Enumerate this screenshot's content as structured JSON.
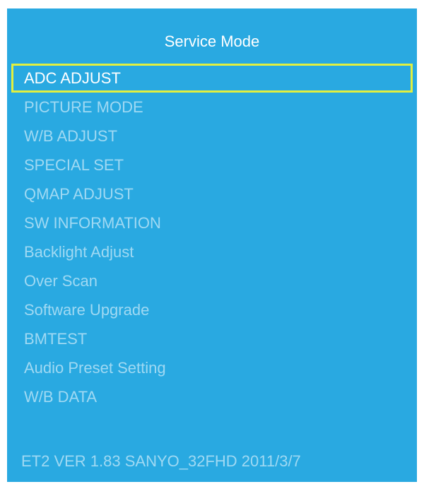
{
  "screen": {
    "title": "Service Mode",
    "selected_index": 0,
    "colors": {
      "background": "#29a9e1",
      "title_text": "#ffffff",
      "item_text": "#9fd9f3",
      "selected_text": "#ffffff",
      "selection_border": "#e2f03f"
    }
  },
  "menu": {
    "items": [
      {
        "label": "ADC ADJUST"
      },
      {
        "label": "PICTURE MODE"
      },
      {
        "label": "W/B ADJUST"
      },
      {
        "label": "SPECIAL SET"
      },
      {
        "label": "QMAP ADJUST"
      },
      {
        "label": "SW INFORMATION"
      },
      {
        "label": "Backlight Adjust"
      },
      {
        "label": "Over Scan"
      },
      {
        "label": "Software Upgrade"
      },
      {
        "label": "BMTEST"
      },
      {
        "label": "Audio Preset Setting"
      },
      {
        "label": "W/B DATA"
      }
    ]
  },
  "footer": {
    "version": "ET2 VER 1.83 SANYO_32FHD 2011/3/7"
  }
}
